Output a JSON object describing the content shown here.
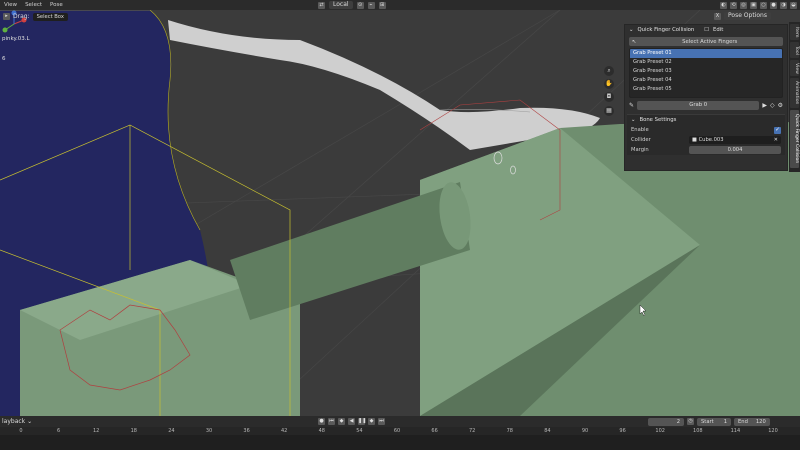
{
  "header": {
    "menu": [
      "View",
      "Select",
      "Pose"
    ],
    "pivot_label": "Local"
  },
  "toolbar": {
    "drag_label": "Drag:",
    "select_mode": "Select Box"
  },
  "header_right": {
    "pose_options": "Pose Options",
    "x_label": "X"
  },
  "viewport": {
    "bone_name": "pinky.03.L",
    "frame_indicator": "6"
  },
  "npanel": {
    "title": "Quick Finger Collision",
    "edit_label": "Edit",
    "select_fingers_button": "Select Active Fingers",
    "presets": [
      "Grab Preset 01",
      "Grab Preset 02",
      "Grab Preset 03",
      "Grab Preset 04",
      "Grab Preset 05"
    ],
    "selected_preset_index": 0,
    "grab_value": "Grab 0",
    "bone_settings": {
      "title": "Bone Settings",
      "enable_label": "Enable",
      "enabled": true,
      "collider_label": "Collider",
      "collider_value": "Cube.003",
      "margin_label": "Margin",
      "margin_value": "0.004"
    }
  },
  "side_tabs": [
    "Item",
    "Tool",
    "View",
    "Animation",
    "Quick Finger Collision"
  ],
  "timeline": {
    "playback_label": "layback",
    "current_frame": "2",
    "start_label": "Start",
    "start_value": "1",
    "end_label": "End",
    "end_value": "120",
    "ruler": [
      "0",
      "6",
      "12",
      "18",
      "24",
      "30",
      "36",
      "42",
      "48",
      "54",
      "60",
      "66",
      "72",
      "78",
      "84",
      "90",
      "96",
      "102",
      "108",
      "114",
      "120",
      "126"
    ]
  }
}
